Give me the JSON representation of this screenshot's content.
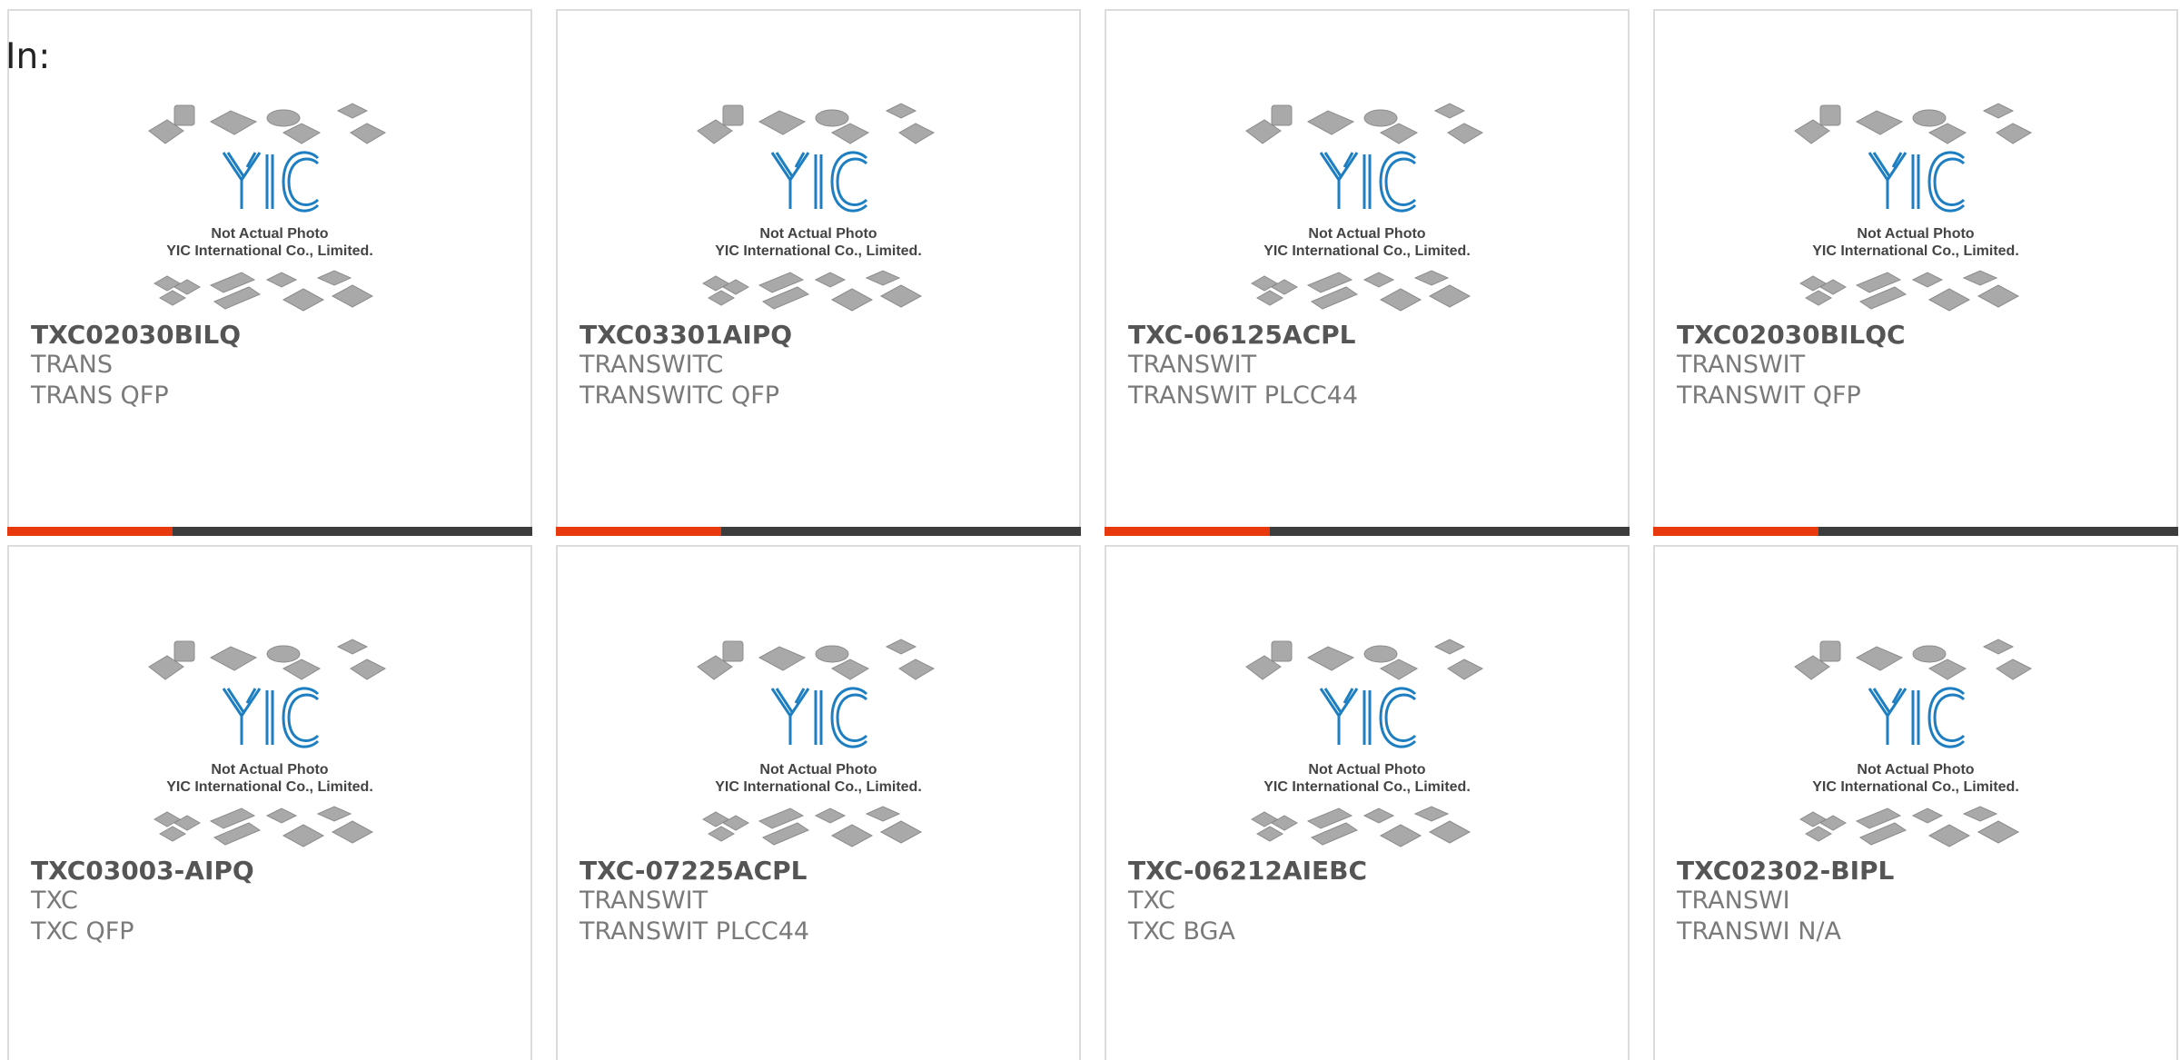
{
  "header": {
    "label": "In:"
  },
  "colors": {
    "accent": "#e8380d",
    "bar_dark": "#3c3c3c",
    "logo_blue": "#1d7ec2",
    "chip_gray": "#a9a9a9"
  },
  "placeholder_image": {
    "brand": "YIC",
    "line1": "Not Actual Photo",
    "line2": "YIC International Co., Limited."
  },
  "products": [
    {
      "part_number": "TXC02030BILQ",
      "manufacturer": "TRANS",
      "description": "TRANS QFP"
    },
    {
      "part_number": "TXC03301AIPQ",
      "manufacturer": "TRANSWITC",
      "description": "TRANSWITC QFP"
    },
    {
      "part_number": "TXC-06125ACPL",
      "manufacturer": "TRANSWIT",
      "description": "TRANSWIT PLCC44"
    },
    {
      "part_number": "TXC02030BILQC",
      "manufacturer": "TRANSWIT",
      "description": "TRANSWIT QFP"
    },
    {
      "part_number": "TXC03003-AIPQ",
      "manufacturer": "TXC",
      "description": "TXC QFP"
    },
    {
      "part_number": "TXC-07225ACPL",
      "manufacturer": "TRANSWIT",
      "description": "TRANSWIT PLCC44"
    },
    {
      "part_number": "TXC-06212AIEBC",
      "manufacturer": "TXC",
      "description": "TXC BGA"
    },
    {
      "part_number": "TXC02302-BIPL",
      "manufacturer": "TRANSWI",
      "description": "TRANSWI N/A"
    }
  ]
}
